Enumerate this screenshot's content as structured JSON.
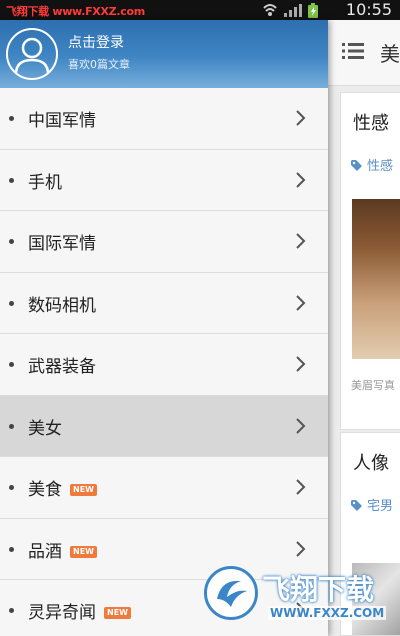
{
  "status_bar": {
    "watermark": "飞翔下载 www.FXXZ.com",
    "time": "10:55",
    "icons": [
      "usb-icon",
      "wifi-icon",
      "signal-icon",
      "battery-icon"
    ]
  },
  "drawer": {
    "login_label": "点击登录",
    "liked_label": "喜欢0篇文章",
    "items": [
      {
        "label": "中国军情",
        "new": false,
        "selected": false
      },
      {
        "label": "手机",
        "new": false,
        "selected": false
      },
      {
        "label": "国际军情",
        "new": false,
        "selected": false
      },
      {
        "label": "数码相机",
        "new": false,
        "selected": false
      },
      {
        "label": "武器装备",
        "new": false,
        "selected": false
      },
      {
        "label": "美女",
        "new": false,
        "selected": true
      },
      {
        "label": "美食",
        "new": true,
        "selected": false
      },
      {
        "label": "品酒",
        "new": true,
        "selected": false
      },
      {
        "label": "灵异奇闻",
        "new": true,
        "selected": false
      }
    ],
    "new_badge_text": "NEW"
  },
  "content": {
    "header_title": "美",
    "cards": [
      {
        "title": "性感",
        "tag": "性感",
        "caption": "美眉写真"
      },
      {
        "title": "人像",
        "tag": "宅男"
      }
    ]
  },
  "watermark_logo": {
    "text": "飞翔下载",
    "url": "WWW.FXXZ.COM"
  },
  "colors": {
    "drawer_header": "#3f86c4",
    "new_badge": "#ef7a3e",
    "selected_row": "#d7d7d7",
    "tag_blue": "#5b8fc7"
  }
}
